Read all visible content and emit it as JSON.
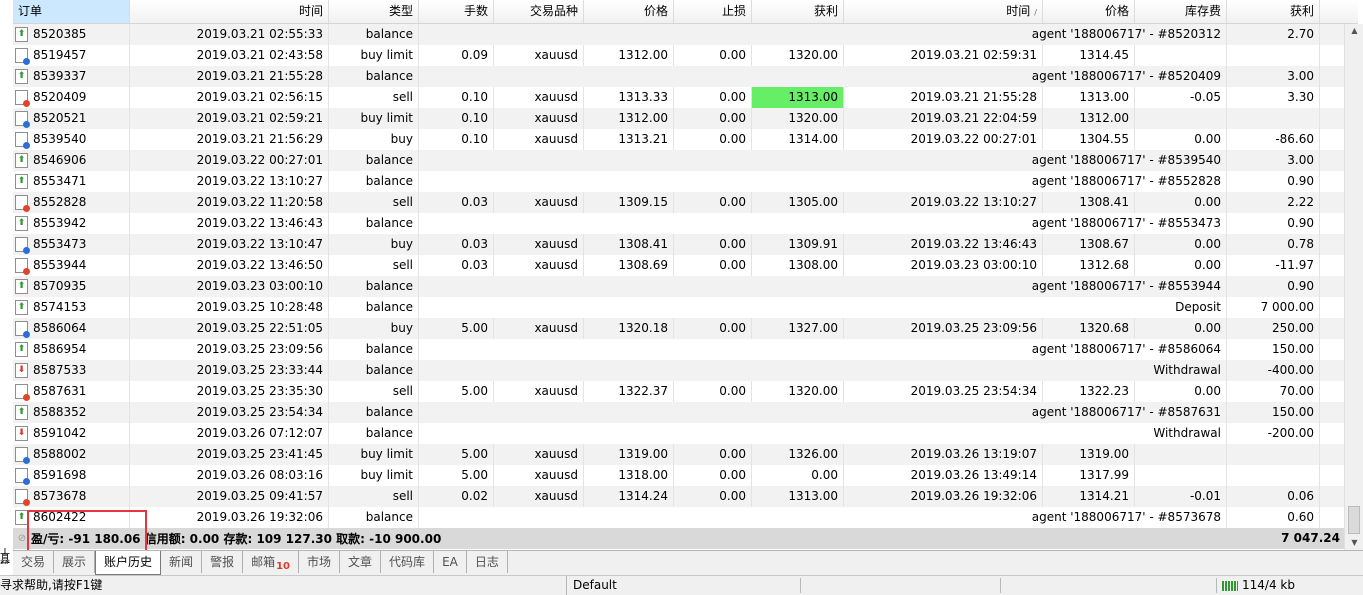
{
  "left_strip_label": "工具箱",
  "columns": [
    "订单",
    "时间",
    "类型",
    "手数",
    "交易品种",
    "价格",
    "止损",
    "获利",
    "时间",
    "价格",
    "库存费",
    "获利"
  ],
  "rows": [
    {
      "order": "8520385",
      "icon": "balance-up",
      "open_time": "2019.03.21 02:55:33",
      "type": "balance",
      "comment": "agent '188006717' - #8520312",
      "profit": "2.70"
    },
    {
      "order": "8519457",
      "icon": "pending-buy",
      "open_time": "2019.03.21 02:43:58",
      "type": "buy limit",
      "lots": "0.09",
      "symbol": "xauusd",
      "price": "1312.00",
      "sl": "0.00",
      "tp": "1320.00",
      "close_time": "2019.03.21 02:59:31",
      "close_price": "1314.45",
      "swap": "",
      "profit": ""
    },
    {
      "order": "8539337",
      "icon": "balance-up",
      "open_time": "2019.03.21 21:55:28",
      "type": "balance",
      "comment": "agent '188006717' - #8520409",
      "profit": "3.00"
    },
    {
      "order": "8520409",
      "icon": "sell",
      "open_time": "2019.03.21 02:56:15",
      "type": "sell",
      "lots": "0.10",
      "symbol": "xauusd",
      "price": "1313.33",
      "sl": "0.00",
      "tp": "1313.00",
      "tp_hit": true,
      "close_time": "2019.03.21 21:55:28",
      "close_price": "1313.00",
      "swap": "-0.05",
      "profit": "3.30"
    },
    {
      "order": "8520521",
      "icon": "pending-buy",
      "open_time": "2019.03.21 02:59:21",
      "type": "buy limit",
      "lots": "0.10",
      "symbol": "xauusd",
      "price": "1312.00",
      "sl": "0.00",
      "tp": "1320.00",
      "close_time": "2019.03.21 22:04:59",
      "close_price": "1312.00",
      "swap": "",
      "profit": ""
    },
    {
      "order": "8539540",
      "icon": "buy",
      "open_time": "2019.03.21 21:56:29",
      "type": "buy",
      "lots": "0.10",
      "symbol": "xauusd",
      "price": "1313.21",
      "sl": "0.00",
      "tp": "1314.00",
      "close_time": "2019.03.22 00:27:01",
      "close_price": "1304.55",
      "swap": "0.00",
      "profit": "-86.60"
    },
    {
      "order": "8546906",
      "icon": "balance-up",
      "open_time": "2019.03.22 00:27:01",
      "type": "balance",
      "comment": "agent '188006717' - #8539540",
      "profit": "3.00"
    },
    {
      "order": "8553471",
      "icon": "balance-up",
      "open_time": "2019.03.22 13:10:27",
      "type": "balance",
      "comment": "agent '188006717' - #8552828",
      "profit": "0.90"
    },
    {
      "order": "8552828",
      "icon": "sell",
      "open_time": "2019.03.22 11:20:58",
      "type": "sell",
      "lots": "0.03",
      "symbol": "xauusd",
      "price": "1309.15",
      "sl": "0.00",
      "tp": "1305.00",
      "close_time": "2019.03.22 13:10:27",
      "close_price": "1308.41",
      "swap": "0.00",
      "profit": "2.22"
    },
    {
      "order": "8553942",
      "icon": "balance-up",
      "open_time": "2019.03.22 13:46:43",
      "type": "balance",
      "comment": "agent '188006717' - #8553473",
      "profit": "0.90"
    },
    {
      "order": "8553473",
      "icon": "buy",
      "open_time": "2019.03.22 13:10:47",
      "type": "buy",
      "lots": "0.03",
      "symbol": "xauusd",
      "price": "1308.41",
      "sl": "0.00",
      "tp": "1309.91",
      "close_time": "2019.03.22 13:46:43",
      "close_price": "1308.67",
      "swap": "0.00",
      "profit": "0.78"
    },
    {
      "order": "8553944",
      "icon": "sell",
      "open_time": "2019.03.22 13:46:50",
      "type": "sell",
      "lots": "0.03",
      "symbol": "xauusd",
      "price": "1308.69",
      "sl": "0.00",
      "tp": "1308.00",
      "close_time": "2019.03.23 03:00:10",
      "close_price": "1312.68",
      "swap": "0.00",
      "profit": "-11.97"
    },
    {
      "order": "8570935",
      "icon": "balance-up",
      "open_time": "2019.03.23 03:00:10",
      "type": "balance",
      "comment": "agent '188006717' - #8553944",
      "profit": "0.90"
    },
    {
      "order": "8574153",
      "icon": "balance-up",
      "open_time": "2019.03.25 10:28:48",
      "type": "balance",
      "comment": "Deposit",
      "profit": "7 000.00"
    },
    {
      "order": "8586064",
      "icon": "buy",
      "open_time": "2019.03.25 22:51:05",
      "type": "buy",
      "lots": "5.00",
      "symbol": "xauusd",
      "price": "1320.18",
      "sl": "0.00",
      "tp": "1327.00",
      "close_time": "2019.03.25 23:09:56",
      "close_price": "1320.68",
      "swap": "0.00",
      "profit": "250.00"
    },
    {
      "order": "8586954",
      "icon": "balance-up",
      "open_time": "2019.03.25 23:09:56",
      "type": "balance",
      "comment": "agent '188006717' - #8586064",
      "profit": "150.00"
    },
    {
      "order": "8587533",
      "icon": "balance-down",
      "open_time": "2019.03.25 23:33:44",
      "type": "balance",
      "comment": "Withdrawal",
      "profit": "-400.00"
    },
    {
      "order": "8587631",
      "icon": "sell",
      "open_time": "2019.03.25 23:35:30",
      "type": "sell",
      "lots": "5.00",
      "symbol": "xauusd",
      "price": "1322.37",
      "sl": "0.00",
      "tp": "1320.00",
      "close_time": "2019.03.25 23:54:34",
      "close_price": "1322.23",
      "swap": "0.00",
      "profit": "70.00"
    },
    {
      "order": "8588352",
      "icon": "balance-up",
      "open_time": "2019.03.25 23:54:34",
      "type": "balance",
      "comment": "agent '188006717' - #8587631",
      "profit": "150.00"
    },
    {
      "order": "8591042",
      "icon": "balance-down",
      "open_time": "2019.03.26 07:12:07",
      "type": "balance",
      "comment": "Withdrawal",
      "profit": "-200.00"
    },
    {
      "order": "8588002",
      "icon": "pending-buy",
      "open_time": "2019.03.25 23:41:45",
      "type": "buy limit",
      "lots": "5.00",
      "symbol": "xauusd",
      "price": "1319.00",
      "sl": "0.00",
      "tp": "1326.00",
      "close_time": "2019.03.26 13:19:07",
      "close_price": "1319.00",
      "swap": "",
      "profit": ""
    },
    {
      "order": "8591698",
      "icon": "pending-buy",
      "open_time": "2019.03.26 08:03:16",
      "type": "buy limit",
      "lots": "5.00",
      "symbol": "xauusd",
      "price": "1318.00",
      "sl": "0.00",
      "tp": "0.00",
      "close_time": "2019.03.26 13:49:14",
      "close_price": "1317.99",
      "swap": "",
      "profit": ""
    },
    {
      "order": "8573678",
      "icon": "sell",
      "open_time": "2019.03.25 09:41:57",
      "type": "sell",
      "lots": "0.02",
      "symbol": "xauusd",
      "price": "1314.24",
      "sl": "0.00",
      "tp": "1313.00",
      "close_time": "2019.03.26 19:32:06",
      "close_price": "1314.21",
      "swap": "-0.01",
      "profit": "0.06"
    },
    {
      "order": "8602422",
      "icon": "balance-up",
      "open_time": "2019.03.26 19:32:06",
      "type": "balance",
      "comment": "agent '188006717' - #8573678",
      "profit": "0.60"
    }
  ],
  "summary": {
    "text": "盈/亏: -91 180.06  信用额: 0.00  存款: 109 127.30  取款: -10 900.00",
    "total": "7 047.24"
  },
  "tabs": [
    {
      "label": "交易"
    },
    {
      "label": "展示"
    },
    {
      "label": "账户历史",
      "active": true
    },
    {
      "label": "新闻"
    },
    {
      "label": "警报"
    },
    {
      "label": "邮箱",
      "badge": "10"
    },
    {
      "label": "市场"
    },
    {
      "label": "文章"
    },
    {
      "label": "代码库"
    },
    {
      "label": "EA"
    },
    {
      "label": "日志"
    }
  ],
  "status": {
    "help": "寻求帮助,请按F1键",
    "profile": "Default",
    "connection": "114/4 kb"
  },
  "colors": {
    "tp_hit": "#66ee66",
    "header_selected": "#cce8ff",
    "annotation": "#e8343c",
    "badge": "#d93b2b"
  }
}
